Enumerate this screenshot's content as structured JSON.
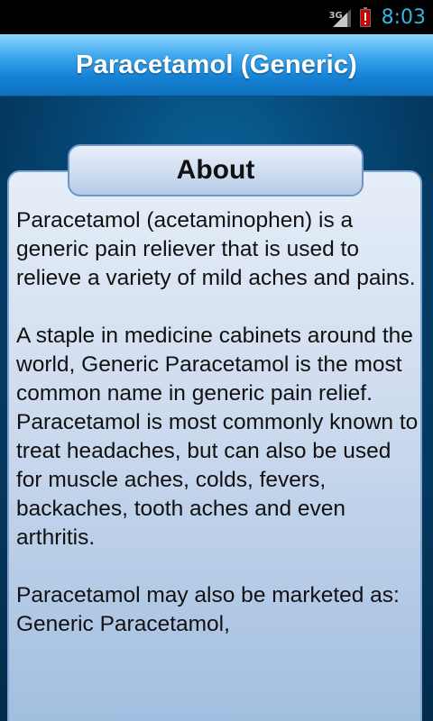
{
  "status_bar": {
    "network_type": "3G",
    "time": "8:03",
    "icons": [
      "signal-icon",
      "battery-alert-icon"
    ],
    "clock_color": "#33b5e5",
    "battery_alert_color": "#cc0000"
  },
  "header": {
    "title": "Paracetamol (Generic)"
  },
  "section": {
    "heading": "About",
    "paragraphs": [
      "Paracetamol (acetaminophen) is a generic pain reliever that is used to relieve a variety of mild aches and pains.",
      "A staple in medicine cabinets around the world, Generic Paracetamol is the most common name in generic pain relief. Paracetamol is most commonly known to treat headaches, but can also be used for muscle aches, colds, fevers, backaches, tooth aches and even arthritis.",
      "Paracetamol may also be marketed as:",
      "Generic Paracetamol,"
    ]
  }
}
